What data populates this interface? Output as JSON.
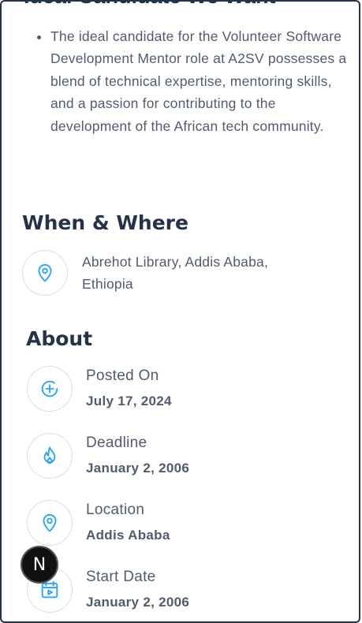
{
  "ideal": {
    "heading": "Ideal Candidate We Want",
    "bullets": [
      "The ideal candidate for the Volunteer Software Development Mentor role at A2SV possesses a blend of technical expertise, mentoring skills, and a passion for contributing to the development of the African tech community."
    ]
  },
  "when_where": {
    "heading": "When & Where",
    "icon": "location-pin-icon",
    "location": "Abrehot Library, Addis Ababa, Ethiopia"
  },
  "about": {
    "heading": "About",
    "items": [
      {
        "label": "Posted On",
        "value": "July 17, 2024",
        "icon": "plus-circle-icon"
      },
      {
        "label": "Deadline",
        "value": "January 2, 2006",
        "icon": "fire-icon"
      },
      {
        "label": "Location",
        "value": "Addis Ababa",
        "icon": "location-pin-icon"
      },
      {
        "label": "Start Date",
        "value": "January 2, 2006",
        "icon": "calendar-icon"
      }
    ]
  },
  "floating_button": {
    "label": "N"
  },
  "colors": {
    "accent": "#26a4ff",
    "heading": "#25324b",
    "body": "#515b6f",
    "border": "#d6ddeb"
  }
}
